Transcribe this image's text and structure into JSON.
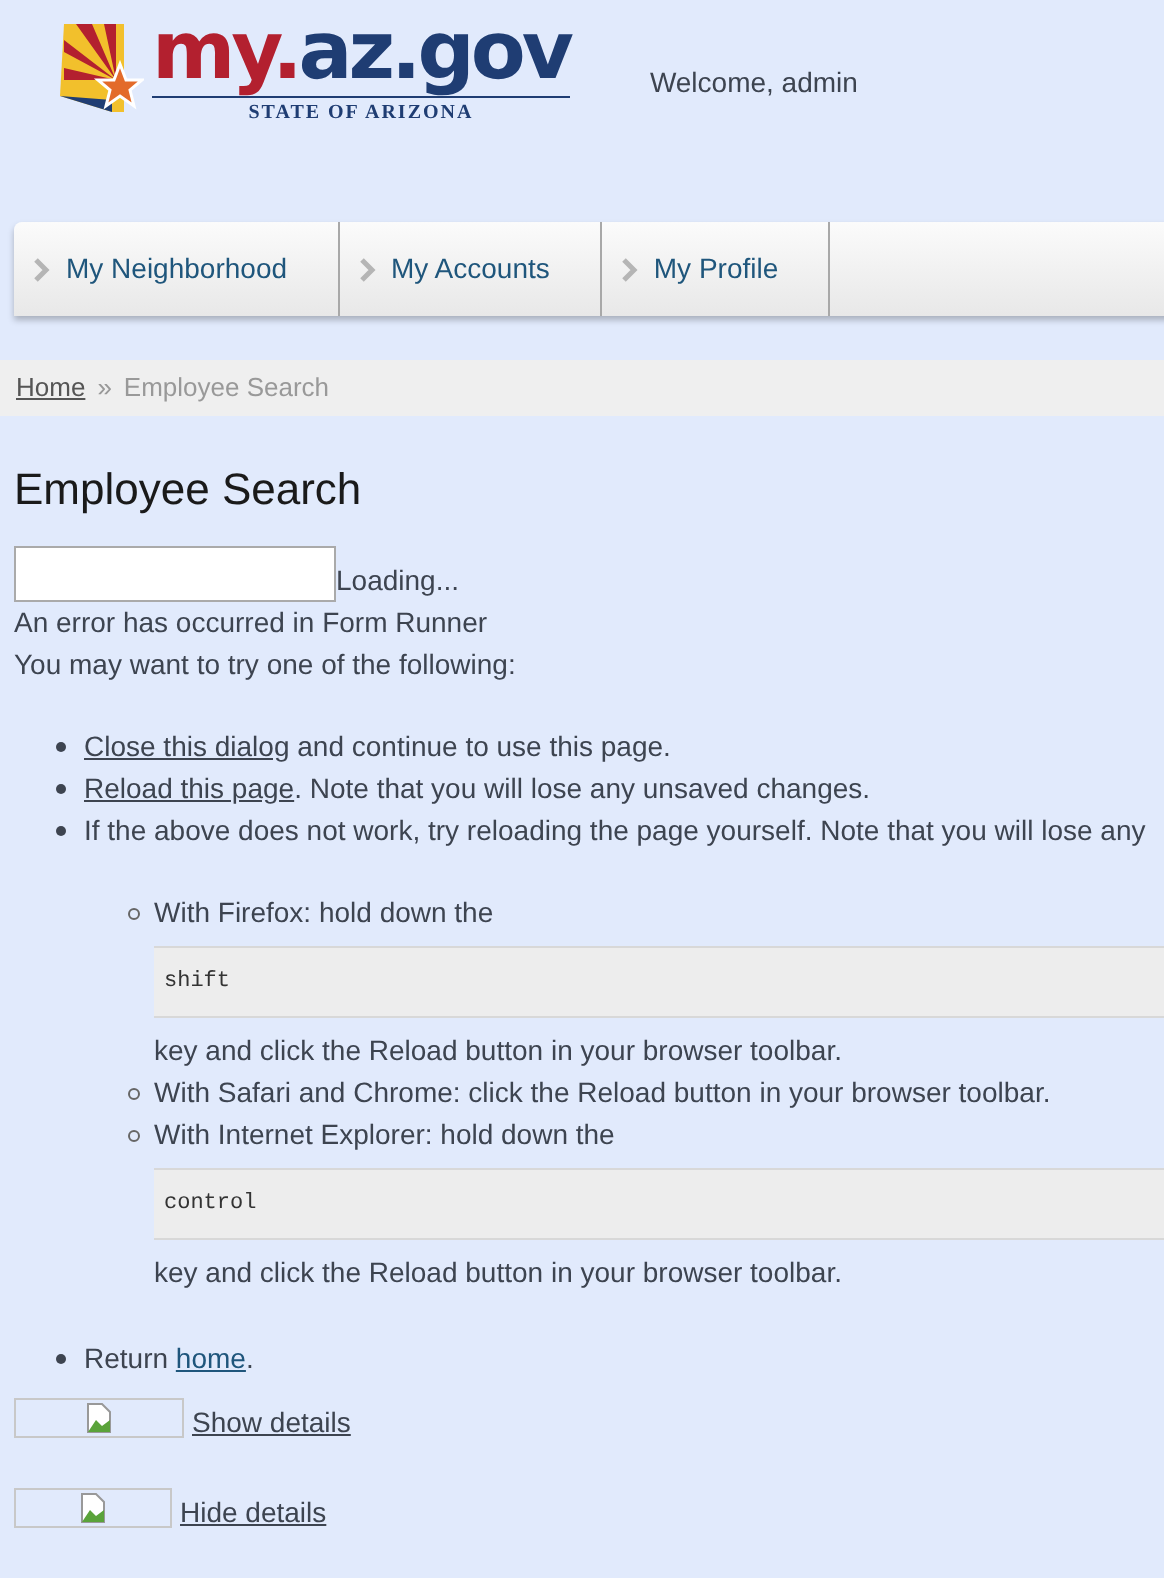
{
  "logo": {
    "parts": [
      {
        "text": "my.",
        "color": "#b3202f"
      },
      {
        "text": "az.gov",
        "color": "#1f3d73"
      }
    ],
    "tagline": "STATE OF ARIZONA"
  },
  "welcome": "Welcome, admin",
  "nav": [
    {
      "label": "My Neighborhood"
    },
    {
      "label": "My Accounts"
    },
    {
      "label": "My Profile"
    }
  ],
  "breadcrumb": {
    "home": "Home",
    "separator": "»",
    "current": "Employee Search"
  },
  "title": "Employee Search",
  "search": {
    "status": "Loading..."
  },
  "error": {
    "message": "An error has occurred in Form Runner",
    "prompt": "You may want to try one of the following:",
    "items": [
      {
        "kind": "link_first",
        "link": "Close this dialog",
        "text": " and continue to use this page."
      },
      {
        "kind": "link_first",
        "link": "Reload this page",
        "text": ". Note that you will lose any unsaved changes."
      },
      {
        "kind": "plain",
        "text": "If the above does not work, try reloading the page yourself. Note that you will lose any",
        "children": [
          {
            "text": "With Firefox: hold down the",
            "key": "shift",
            "after": "key and click the Reload button in your browser toolbar."
          },
          {
            "text": "With Safari and Chrome: click the Reload button in your browser toolbar."
          },
          {
            "text": "With Internet Explorer: hold down the",
            "key": "control",
            "after": "key and click the Reload button in your browser toolbar."
          }
        ]
      },
      {
        "kind": "link_last",
        "text": "Return ",
        "link": "home",
        "after": "."
      }
    ]
  },
  "details": [
    {
      "label": "Show details"
    },
    {
      "label": "Hide details"
    }
  ]
}
